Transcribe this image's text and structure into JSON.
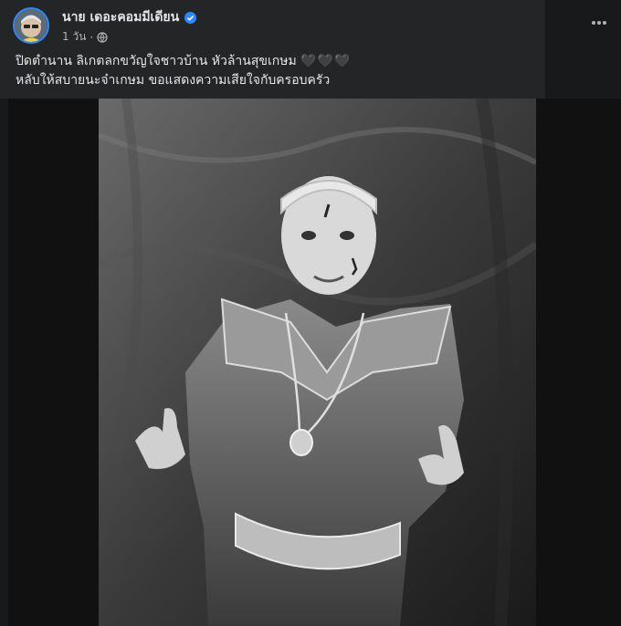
{
  "post": {
    "author": "นาย เดอะคอมมีเดียน",
    "time": "1 วัน",
    "caption_line1": "ปิดตำนาน ลิเกตลกขวัญใจชาวบ้าน หัวล้านสุขเกษม",
    "hearts": "🖤🖤🖤",
    "caption_line2": "หลับให้สบายนะจ๋าเกษม ขอแสดงความเสียใจกับครอบครัว"
  },
  "icons": {
    "verified": "verified-badge-icon",
    "audience": "globe-icon",
    "menu": "more-options-icon"
  },
  "colors": {
    "background": "#18191a",
    "card": "#242526",
    "text": "#e4e6eb",
    "secondary_text": "#b0b3b8",
    "accent": "#2d88ff"
  }
}
